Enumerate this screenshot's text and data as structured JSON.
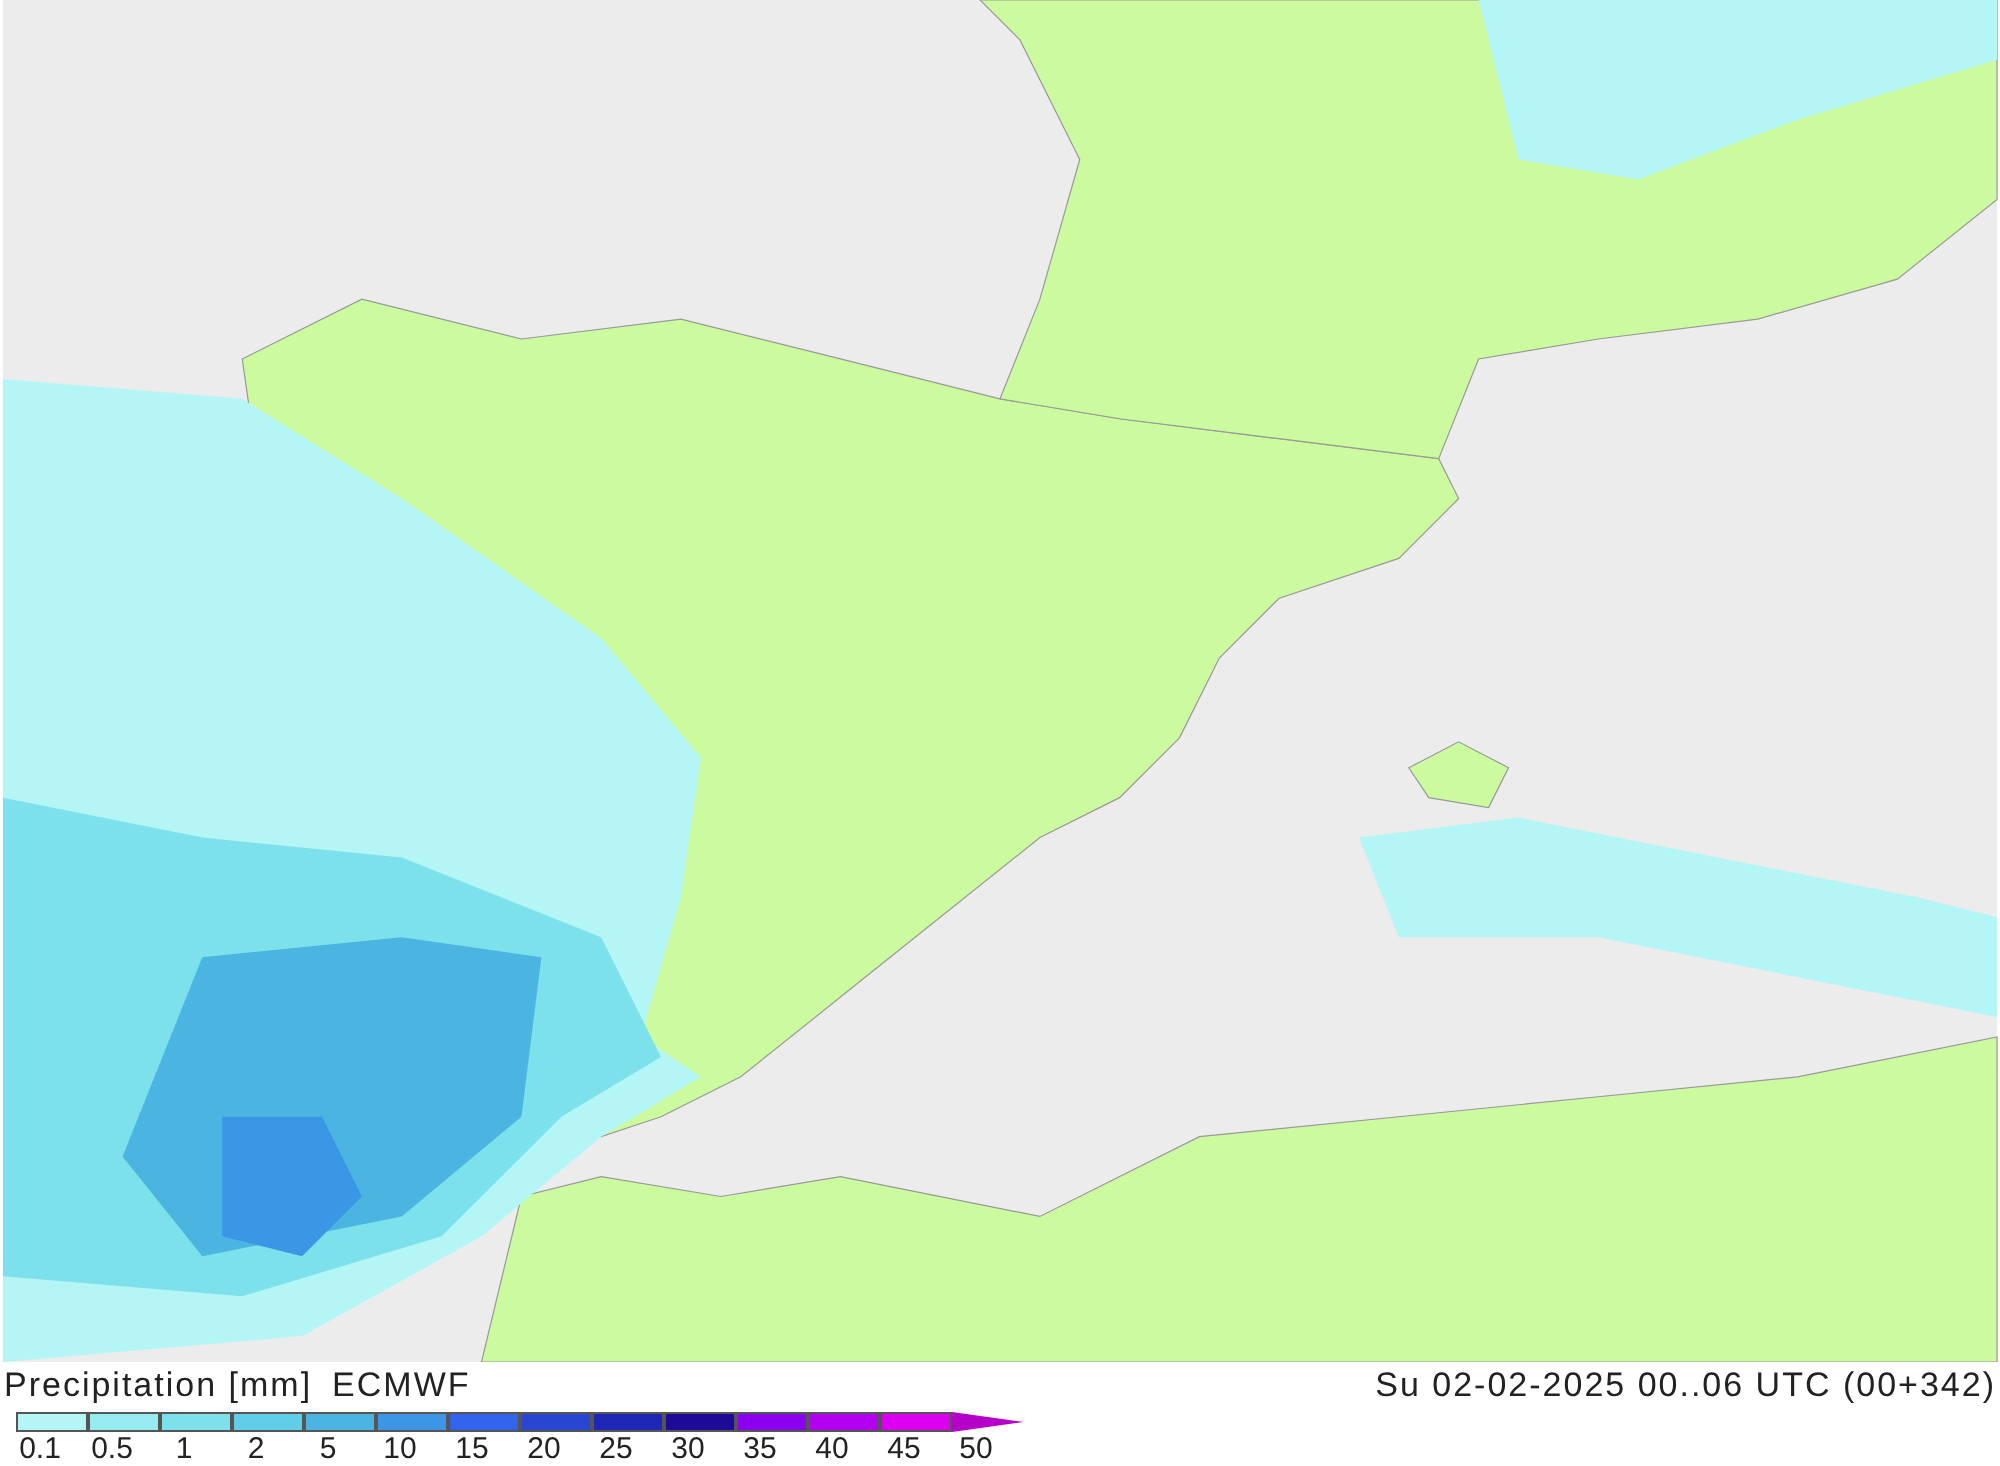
{
  "title": "Precipitation [mm]",
  "model": "ECMWF",
  "valid_time": "Su 02-02-2025 00..06 UTC (00+342)",
  "legend_steps": [
    {
      "kind": "box",
      "color": "#b4f5f5"
    },
    {
      "kind": "box",
      "color": "#96ebf0"
    },
    {
      "kind": "box",
      "color": "#7de1eb"
    },
    {
      "kind": "box",
      "color": "#5fcde6"
    },
    {
      "kind": "box",
      "color": "#4bb4e1"
    },
    {
      "kind": "box",
      "color": "#3c96e6"
    },
    {
      "kind": "box",
      "color": "#3264eb"
    },
    {
      "kind": "box",
      "color": "#2846d2"
    },
    {
      "kind": "box",
      "color": "#1e28b4"
    },
    {
      "kind": "box",
      "color": "#1e0a96"
    },
    {
      "kind": "box",
      "color": "#8c00f0"
    },
    {
      "kind": "box",
      "color": "#b400f0"
    },
    {
      "kind": "box",
      "color": "#dc00f0"
    },
    {
      "kind": "arrow",
      "color": "#b400c8"
    }
  ],
  "legend_labels": [
    "0.1",
    "0.5",
    "1",
    "2",
    "5",
    "10",
    "15",
    "20",
    "25",
    "30",
    "35",
    "40",
    "45",
    "50"
  ]
}
